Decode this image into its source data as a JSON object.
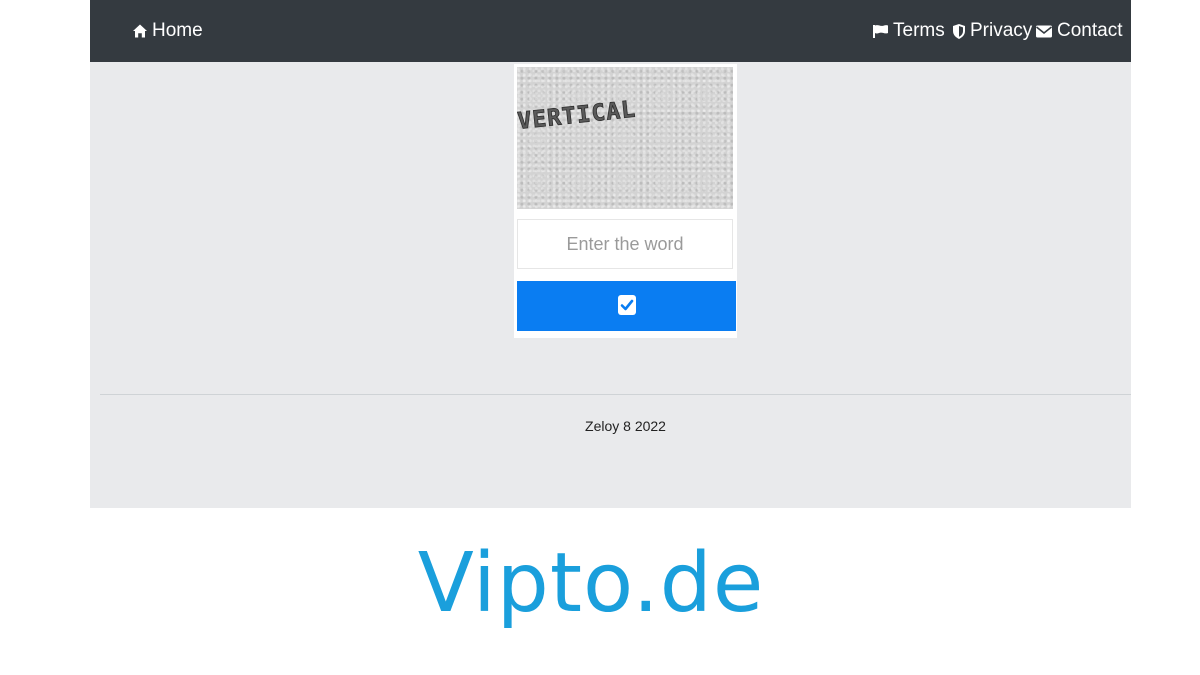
{
  "navbar": {
    "home_label": "Home",
    "terms_label": "Terms",
    "privacy_label": "Privacy",
    "contact_label": "Contact"
  },
  "captcha": {
    "image_word": "VERTICAL",
    "input_placeholder": "Enter the word",
    "input_value": ""
  },
  "footer": {
    "text": "Zeloy 8 2022"
  },
  "watermark": {
    "text": "Vipto.de"
  },
  "colors": {
    "navbar": "#343a40",
    "page_background": "#e9eaec",
    "submit_button": "#0a7df2",
    "watermark": "#1a9fdc"
  },
  "icons": {
    "home": "home-icon",
    "terms": "flag-icon",
    "privacy": "shield-icon",
    "contact": "envelope-icon",
    "submit": "checkbox-checked-icon"
  }
}
